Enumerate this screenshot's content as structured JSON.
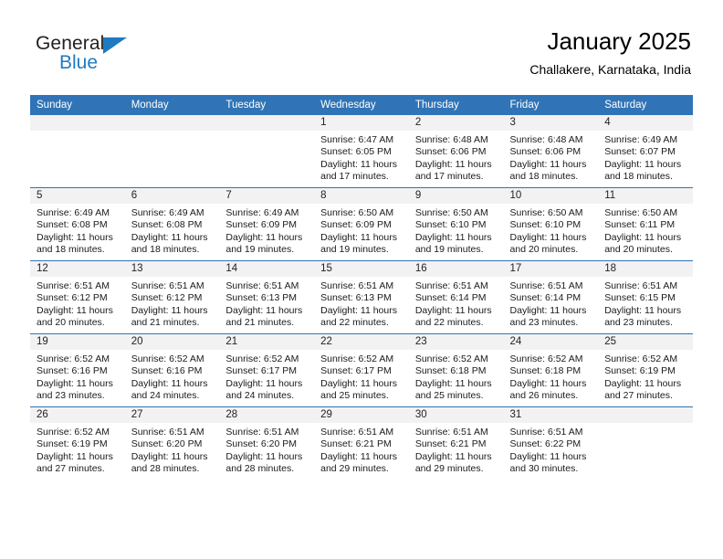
{
  "brand": {
    "name_part1": "General",
    "name_part2": "Blue",
    "accent_color": "#1f7bc1"
  },
  "header": {
    "title": "January 2025",
    "subtitle": "Challakere, Karnataka, India"
  },
  "theme": {
    "header_bar_color": "#3074b7",
    "daynum_band_color": "#f2f2f2",
    "grid_line_color": "#3074b7"
  },
  "weekday_headers": [
    "Sunday",
    "Monday",
    "Tuesday",
    "Wednesday",
    "Thursday",
    "Friday",
    "Saturday"
  ],
  "weeks": [
    [
      {
        "day": "",
        "empty": true
      },
      {
        "day": "",
        "empty": true
      },
      {
        "day": "",
        "empty": true
      },
      {
        "day": "1",
        "sunrise": "Sunrise: 6:47 AM",
        "sunset": "Sunset: 6:05 PM",
        "daylight_line1": "Daylight: 11 hours",
        "daylight_line2": "and 17 minutes."
      },
      {
        "day": "2",
        "sunrise": "Sunrise: 6:48 AM",
        "sunset": "Sunset: 6:06 PM",
        "daylight_line1": "Daylight: 11 hours",
        "daylight_line2": "and 17 minutes."
      },
      {
        "day": "3",
        "sunrise": "Sunrise: 6:48 AM",
        "sunset": "Sunset: 6:06 PM",
        "daylight_line1": "Daylight: 11 hours",
        "daylight_line2": "and 18 minutes."
      },
      {
        "day": "4",
        "sunrise": "Sunrise: 6:49 AM",
        "sunset": "Sunset: 6:07 PM",
        "daylight_line1": "Daylight: 11 hours",
        "daylight_line2": "and 18 minutes."
      }
    ],
    [
      {
        "day": "5",
        "sunrise": "Sunrise: 6:49 AM",
        "sunset": "Sunset: 6:08 PM",
        "daylight_line1": "Daylight: 11 hours",
        "daylight_line2": "and 18 minutes."
      },
      {
        "day": "6",
        "sunrise": "Sunrise: 6:49 AM",
        "sunset": "Sunset: 6:08 PM",
        "daylight_line1": "Daylight: 11 hours",
        "daylight_line2": "and 18 minutes."
      },
      {
        "day": "7",
        "sunrise": "Sunrise: 6:49 AM",
        "sunset": "Sunset: 6:09 PM",
        "daylight_line1": "Daylight: 11 hours",
        "daylight_line2": "and 19 minutes."
      },
      {
        "day": "8",
        "sunrise": "Sunrise: 6:50 AM",
        "sunset": "Sunset: 6:09 PM",
        "daylight_line1": "Daylight: 11 hours",
        "daylight_line2": "and 19 minutes."
      },
      {
        "day": "9",
        "sunrise": "Sunrise: 6:50 AM",
        "sunset": "Sunset: 6:10 PM",
        "daylight_line1": "Daylight: 11 hours",
        "daylight_line2": "and 19 minutes."
      },
      {
        "day": "10",
        "sunrise": "Sunrise: 6:50 AM",
        "sunset": "Sunset: 6:10 PM",
        "daylight_line1": "Daylight: 11 hours",
        "daylight_line2": "and 20 minutes."
      },
      {
        "day": "11",
        "sunrise": "Sunrise: 6:50 AM",
        "sunset": "Sunset: 6:11 PM",
        "daylight_line1": "Daylight: 11 hours",
        "daylight_line2": "and 20 minutes."
      }
    ],
    [
      {
        "day": "12",
        "sunrise": "Sunrise: 6:51 AM",
        "sunset": "Sunset: 6:12 PM",
        "daylight_line1": "Daylight: 11 hours",
        "daylight_line2": "and 20 minutes."
      },
      {
        "day": "13",
        "sunrise": "Sunrise: 6:51 AM",
        "sunset": "Sunset: 6:12 PM",
        "daylight_line1": "Daylight: 11 hours",
        "daylight_line2": "and 21 minutes."
      },
      {
        "day": "14",
        "sunrise": "Sunrise: 6:51 AM",
        "sunset": "Sunset: 6:13 PM",
        "daylight_line1": "Daylight: 11 hours",
        "daylight_line2": "and 21 minutes."
      },
      {
        "day": "15",
        "sunrise": "Sunrise: 6:51 AM",
        "sunset": "Sunset: 6:13 PM",
        "daylight_line1": "Daylight: 11 hours",
        "daylight_line2": "and 22 minutes."
      },
      {
        "day": "16",
        "sunrise": "Sunrise: 6:51 AM",
        "sunset": "Sunset: 6:14 PM",
        "daylight_line1": "Daylight: 11 hours",
        "daylight_line2": "and 22 minutes."
      },
      {
        "day": "17",
        "sunrise": "Sunrise: 6:51 AM",
        "sunset": "Sunset: 6:14 PM",
        "daylight_line1": "Daylight: 11 hours",
        "daylight_line2": "and 23 minutes."
      },
      {
        "day": "18",
        "sunrise": "Sunrise: 6:51 AM",
        "sunset": "Sunset: 6:15 PM",
        "daylight_line1": "Daylight: 11 hours",
        "daylight_line2": "and 23 minutes."
      }
    ],
    [
      {
        "day": "19",
        "sunrise": "Sunrise: 6:52 AM",
        "sunset": "Sunset: 6:16 PM",
        "daylight_line1": "Daylight: 11 hours",
        "daylight_line2": "and 23 minutes."
      },
      {
        "day": "20",
        "sunrise": "Sunrise: 6:52 AM",
        "sunset": "Sunset: 6:16 PM",
        "daylight_line1": "Daylight: 11 hours",
        "daylight_line2": "and 24 minutes."
      },
      {
        "day": "21",
        "sunrise": "Sunrise: 6:52 AM",
        "sunset": "Sunset: 6:17 PM",
        "daylight_line1": "Daylight: 11 hours",
        "daylight_line2": "and 24 minutes."
      },
      {
        "day": "22",
        "sunrise": "Sunrise: 6:52 AM",
        "sunset": "Sunset: 6:17 PM",
        "daylight_line1": "Daylight: 11 hours",
        "daylight_line2": "and 25 minutes."
      },
      {
        "day": "23",
        "sunrise": "Sunrise: 6:52 AM",
        "sunset": "Sunset: 6:18 PM",
        "daylight_line1": "Daylight: 11 hours",
        "daylight_line2": "and 25 minutes."
      },
      {
        "day": "24",
        "sunrise": "Sunrise: 6:52 AM",
        "sunset": "Sunset: 6:18 PM",
        "daylight_line1": "Daylight: 11 hours",
        "daylight_line2": "and 26 minutes."
      },
      {
        "day": "25",
        "sunrise": "Sunrise: 6:52 AM",
        "sunset": "Sunset: 6:19 PM",
        "daylight_line1": "Daylight: 11 hours",
        "daylight_line2": "and 27 minutes."
      }
    ],
    [
      {
        "day": "26",
        "sunrise": "Sunrise: 6:52 AM",
        "sunset": "Sunset: 6:19 PM",
        "daylight_line1": "Daylight: 11 hours",
        "daylight_line2": "and 27 minutes."
      },
      {
        "day": "27",
        "sunrise": "Sunrise: 6:51 AM",
        "sunset": "Sunset: 6:20 PM",
        "daylight_line1": "Daylight: 11 hours",
        "daylight_line2": "and 28 minutes."
      },
      {
        "day": "28",
        "sunrise": "Sunrise: 6:51 AM",
        "sunset": "Sunset: 6:20 PM",
        "daylight_line1": "Daylight: 11 hours",
        "daylight_line2": "and 28 minutes."
      },
      {
        "day": "29",
        "sunrise": "Sunrise: 6:51 AM",
        "sunset": "Sunset: 6:21 PM",
        "daylight_line1": "Daylight: 11 hours",
        "daylight_line2": "and 29 minutes."
      },
      {
        "day": "30",
        "sunrise": "Sunrise: 6:51 AM",
        "sunset": "Sunset: 6:21 PM",
        "daylight_line1": "Daylight: 11 hours",
        "daylight_line2": "and 29 minutes."
      },
      {
        "day": "31",
        "sunrise": "Sunrise: 6:51 AM",
        "sunset": "Sunset: 6:22 PM",
        "daylight_line1": "Daylight: 11 hours",
        "daylight_line2": "and 30 minutes."
      },
      {
        "day": "",
        "empty": true
      }
    ]
  ]
}
